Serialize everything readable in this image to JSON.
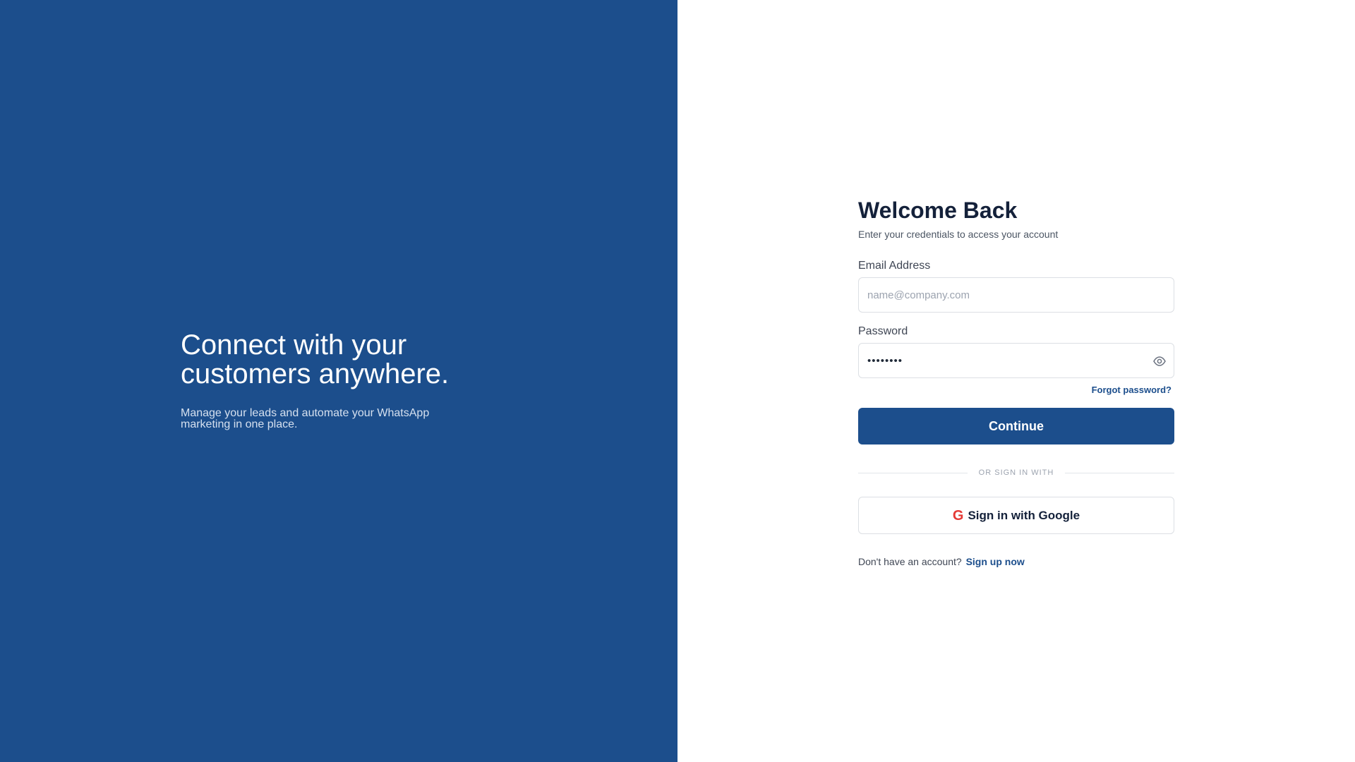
{
  "hero": {
    "title_line1": "Connect with your",
    "title_line2": "customers anywhere.",
    "subtitle": "Manage your leads and automate your WhatsApp marketing in one place."
  },
  "login": {
    "title": "Welcome Back",
    "subtitle": "Enter your credentials to access your account",
    "email_label": "Email Address",
    "email_placeholder": "name@company.com",
    "email_value": "",
    "password_label": "Password",
    "password_value": "••••••••",
    "forgot_label": "Forgot password?",
    "continue_label": "Continue",
    "divider_label": "OR SIGN IN WITH",
    "google_label": "Sign in with Google",
    "google_icon_glyph": "G",
    "signup_prompt": "Don't have an account?",
    "signup_link": "Sign up now"
  },
  "icons": {
    "eye": "eye-icon",
    "google": "google-icon"
  },
  "colors": {
    "brand": "#1c4e8c",
    "google_red": "#e53935",
    "text_dark": "#14213a"
  }
}
